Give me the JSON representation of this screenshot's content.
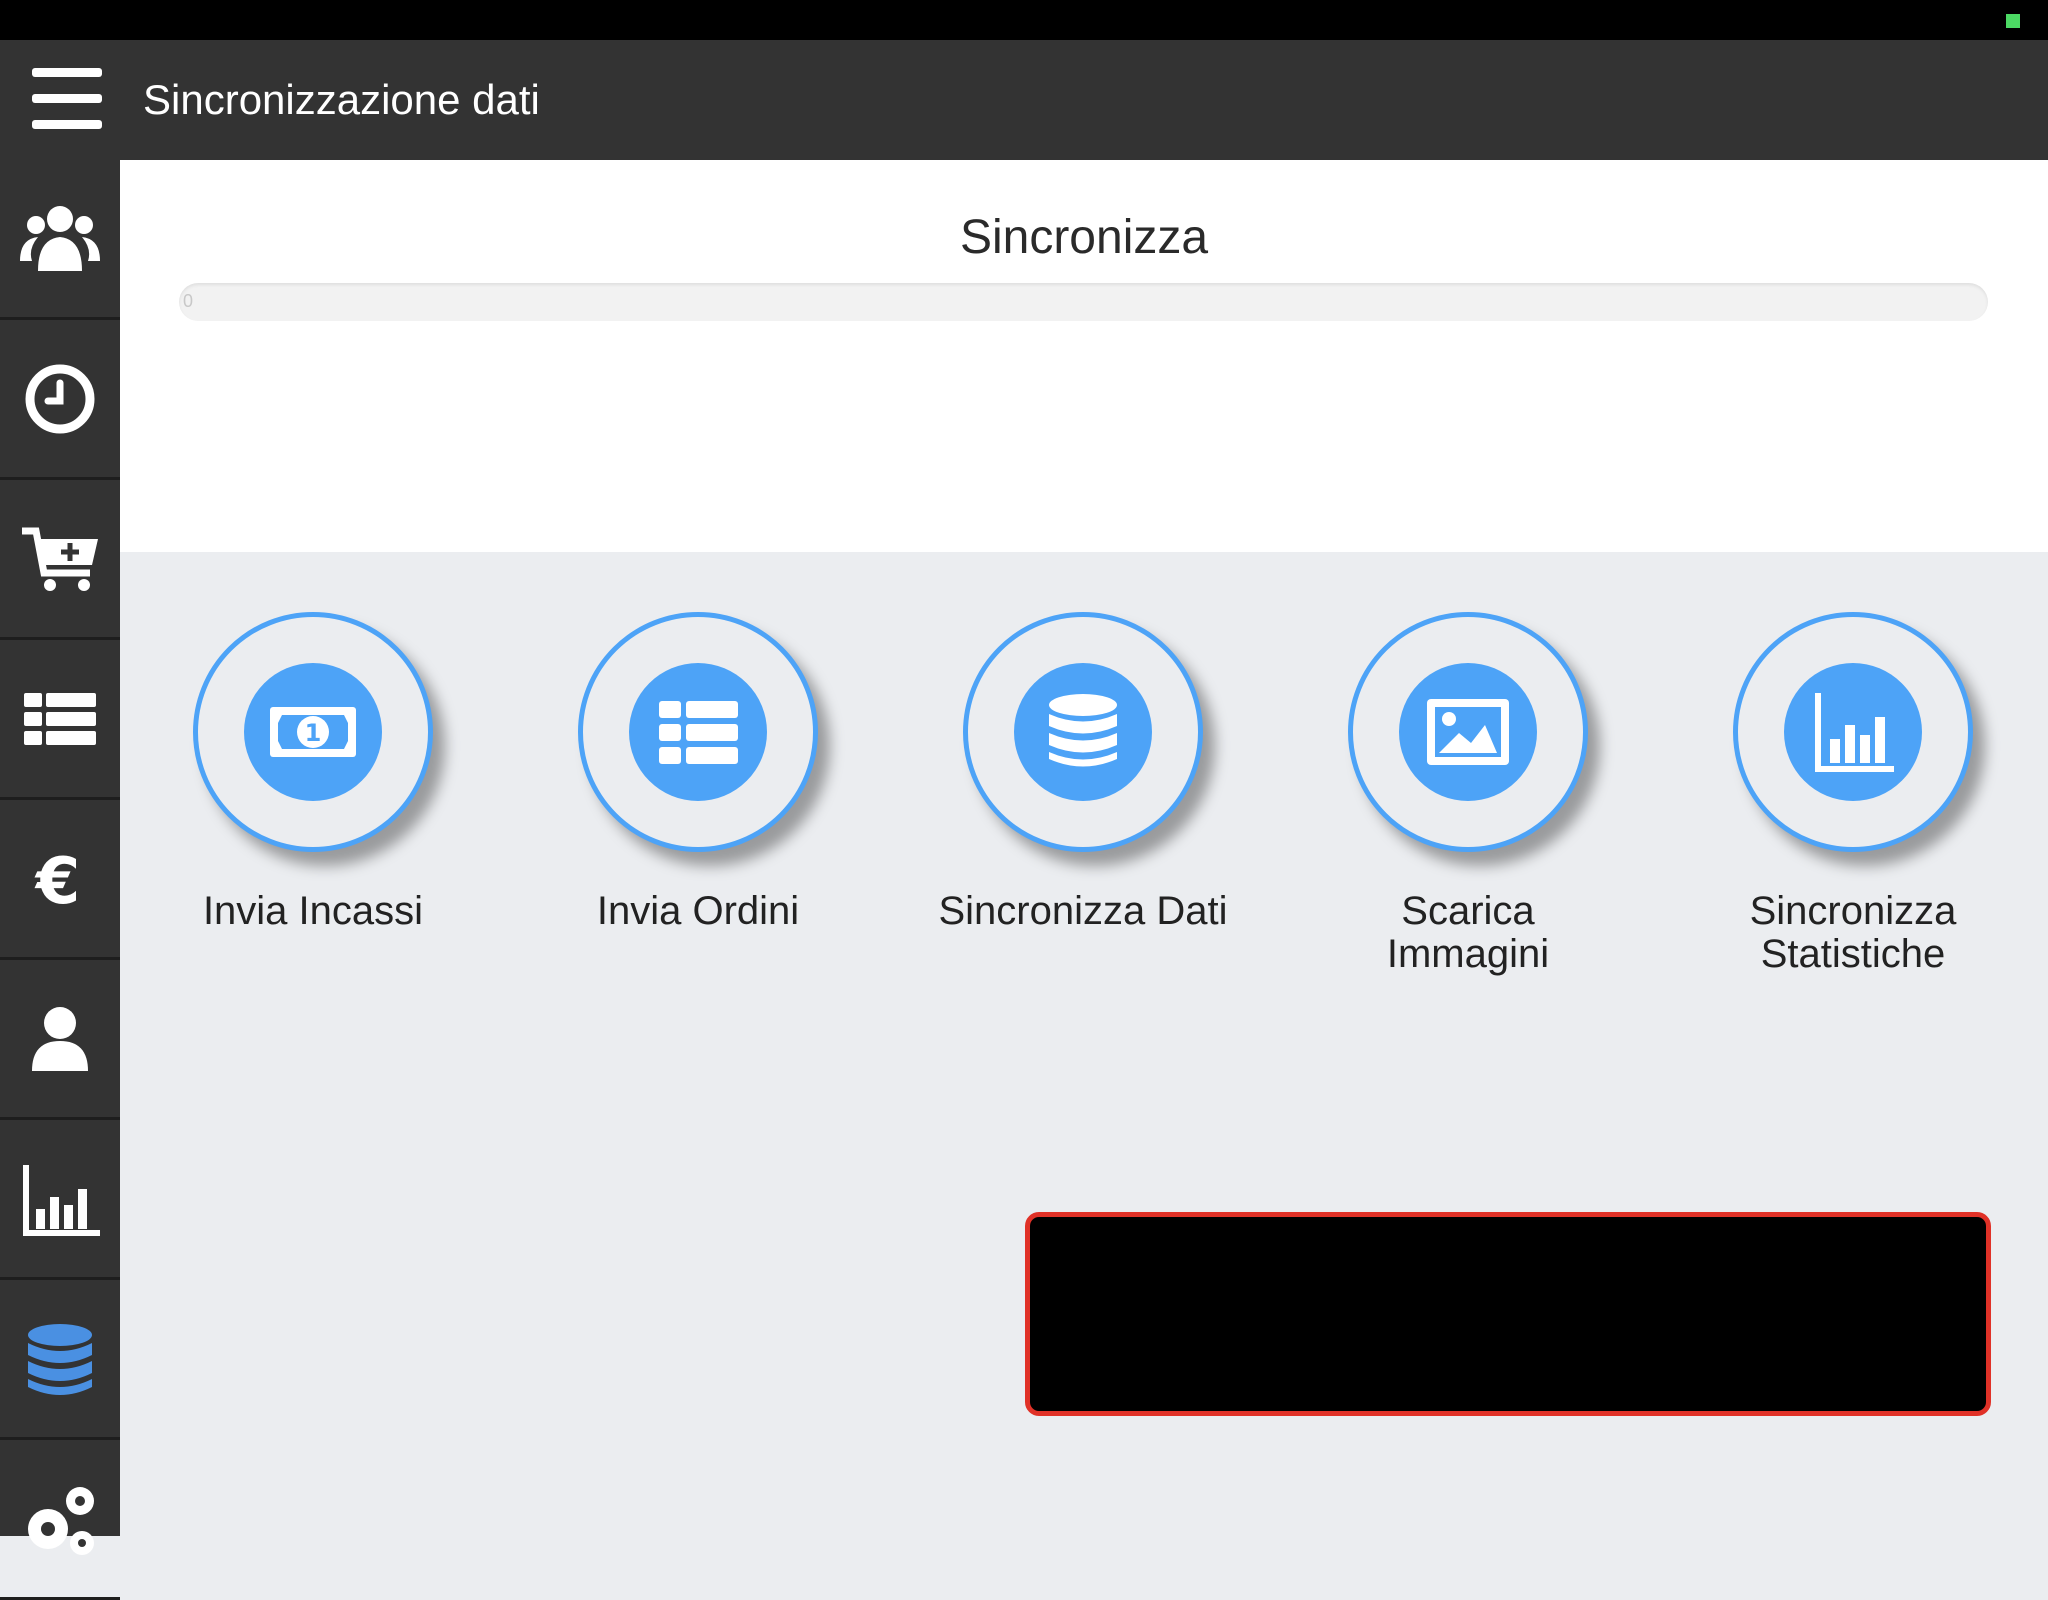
{
  "header": {
    "title": "Sincronizzazione dati"
  },
  "sidebar": {
    "items": [
      {
        "icon": "users-icon"
      },
      {
        "icon": "clock-icon"
      },
      {
        "icon": "cart-plus-icon"
      },
      {
        "icon": "list-icon"
      },
      {
        "icon": "euro-icon"
      },
      {
        "icon": "user-icon"
      },
      {
        "icon": "bar-chart-icon"
      },
      {
        "icon": "database-icon",
        "active": true
      },
      {
        "icon": "gears-icon"
      }
    ],
    "active_color": "#4a90e2"
  },
  "sync": {
    "title": "Sincronizza",
    "progress_value": 0,
    "progress_text": "0"
  },
  "actions": [
    {
      "label": "Invia Incassi",
      "icon": "money-bill-icon"
    },
    {
      "label": "Invia Ordini",
      "icon": "list-icon"
    },
    {
      "label": "Sincronizza Dati",
      "icon": "database-icon"
    },
    {
      "label": "Scarica Immagini",
      "icon": "image-icon"
    },
    {
      "label": "Sincronizza Statistiche",
      "icon": "bar-chart-icon"
    }
  ],
  "colors": {
    "accent": "#4da3f7",
    "appbar": "#333333",
    "alert_border": "#e03127"
  }
}
